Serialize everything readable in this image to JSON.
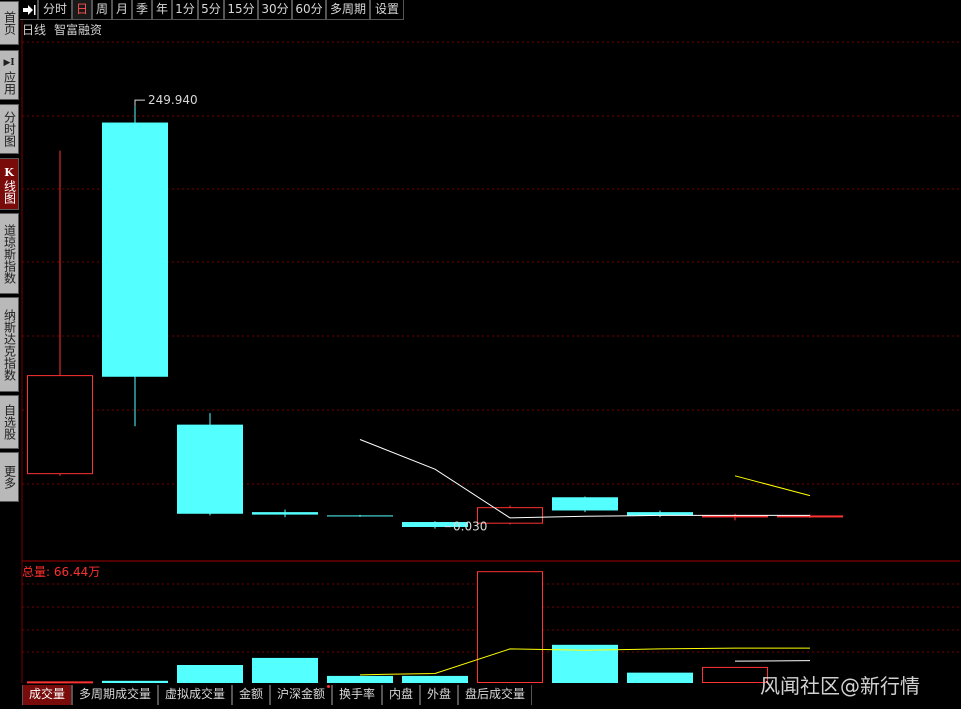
{
  "sidebar": {
    "tabs": [
      {
        "label": "首页"
      },
      {
        "mark": "▶I",
        "label": "应用"
      },
      {
        "label": "分时图"
      },
      {
        "mark": "K",
        "label": "线图"
      },
      {
        "label": "道琼斯指数"
      },
      {
        "label": "纳斯达克指数"
      },
      {
        "label": "自选股"
      },
      {
        "label": "更多"
      }
    ]
  },
  "toolbar": {
    "exit_icon": "exit-arrow-icon",
    "periods": [
      "分时",
      "日",
      "周",
      "月",
      "季",
      "年",
      "1分",
      "5分",
      "15分",
      "30分",
      "60分",
      "多周期",
      "设置"
    ],
    "active": "日"
  },
  "chart_header": {
    "period_label": "日线",
    "security_name": "智富融资"
  },
  "volume_header": {
    "label": "总量: 66.44万"
  },
  "bottom_tabs": {
    "items": [
      "成交量",
      "多周期成交量",
      "虚拟成交量",
      "金额",
      "沪深金额",
      "换手率",
      "内盘",
      "外盘",
      "盘后成交量"
    ],
    "active": "成交量"
  },
  "watermark": "风闻社区@新行情",
  "colors": {
    "up": "#ff3232",
    "down": "#54ffff",
    "ma_white": "#ffffff",
    "ma_yellow": "#ffff00",
    "grid": "#7a0000",
    "active_tab": "#7a0b0b"
  },
  "chart_data": [
    {
      "type": "candlestick",
      "name": "日线",
      "series_name": "智富融资",
      "candles": [
        {
          "open": 27.0,
          "close": 87.0,
          "high": 223.0,
          "low": 26.0,
          "dir": "up"
        },
        {
          "open": 240.0,
          "close": 86.0,
          "high": 249.94,
          "low": 56.0,
          "dir": "down"
        },
        {
          "open": 57.0,
          "close": 3.0,
          "high": 64.0,
          "low": 2.0,
          "dir": "down"
        },
        {
          "open": 4.0,
          "close": 2.5,
          "high": 5.5,
          "low": 1.0,
          "dir": "down"
        },
        {
          "open": 2.0,
          "close": 1.5,
          "high": 2.3,
          "low": 1.2,
          "dir": "down"
        },
        {
          "open": -2.0,
          "close": -5.0,
          "high": -1.5,
          "low": -6.0,
          "dir": "down"
        },
        {
          "open": -3.0,
          "close": 7.0,
          "high": 8.0,
          "low": -3.5,
          "dir": "up"
        },
        {
          "open": 13.0,
          "close": 5.0,
          "high": 13.5,
          "low": 4.0,
          "dir": "down"
        },
        {
          "open": 4.0,
          "close": 2.0,
          "high": 5.0,
          "low": 1.0,
          "dir": "down"
        },
        {
          "open": 1.0,
          "close": 2.0,
          "high": 3.0,
          "low": -1.0,
          "dir": "up"
        },
        {
          "open": 1.0,
          "close": 2.0,
          "high": 2.5,
          "low": 0.5,
          "dir": "up"
        }
      ],
      "high_label": "249.940",
      "low_label": "0.030",
      "ma_white": [
        null,
        null,
        null,
        null,
        48.0,
        30.0,
        0.5,
        1.5,
        2.0,
        2.0,
        2.0
      ],
      "ma_yellow": [
        null,
        null,
        null,
        null,
        null,
        null,
        null,
        null,
        null,
        26.0,
        14.0
      ],
      "ylim": [
        -25,
        290
      ],
      "grid": true
    },
    {
      "type": "bar",
      "name": "成交量",
      "label": "总量: 66.44万",
      "values": [
        0.6,
        0.8,
        6.6,
        9.2,
        2.6,
        2.6,
        41.0,
        14.0,
        3.8,
        5.9,
        0
      ],
      "dir": [
        "up",
        "down",
        "down",
        "down",
        "down",
        "down",
        "up",
        "down",
        "down",
        "up",
        "up"
      ],
      "ma_yellow": [
        null,
        null,
        null,
        null,
        3.0,
        3.5,
        12.5,
        12.0,
        12.5,
        12.8,
        12.8
      ],
      "ma_white": [
        null,
        null,
        null,
        null,
        null,
        null,
        null,
        null,
        null,
        8.0,
        8.2
      ],
      "ylim": [
        0,
        44
      ],
      "grid": true
    }
  ]
}
